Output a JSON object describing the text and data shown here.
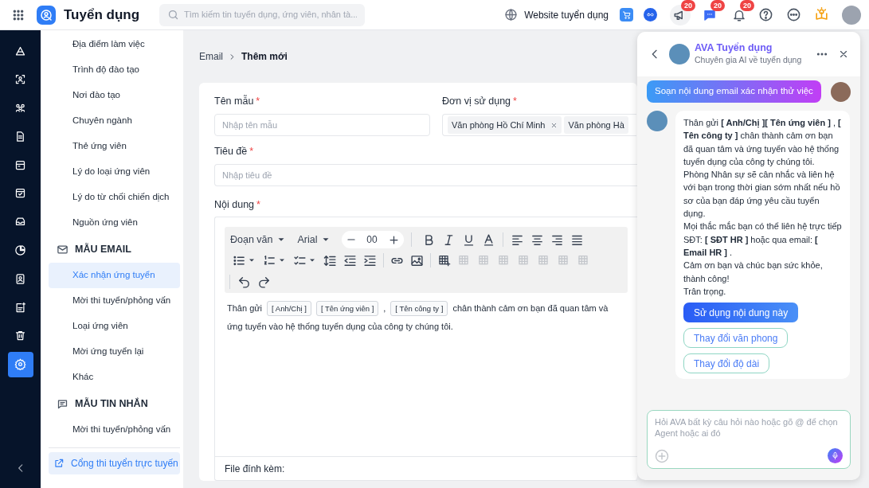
{
  "topbar": {
    "app_title": "Tuyển dụng",
    "search_placeholder": "Tìm kiếm tin tuyển dụng, ứng viên, nhân tà...",
    "website_link": "Website tuyển dụng",
    "badges": [
      "20",
      "20",
      "20"
    ]
  },
  "rail": [
    {
      "selected": false
    },
    {
      "selected": false
    },
    {
      "selected": false
    },
    {
      "selected": false
    },
    {
      "selected": false
    },
    {
      "selected": false
    },
    {
      "selected": false
    },
    {
      "selected": false
    },
    {
      "selected": false
    },
    {
      "selected": false
    },
    {
      "selected": false
    },
    {
      "selected": true
    }
  ],
  "sidebar": {
    "items": [
      {
        "label": "Địa điểm làm việc",
        "selected": false
      },
      {
        "label": "Trình độ đào tạo",
        "selected": false
      },
      {
        "label": "Nơi đào tạo",
        "selected": false
      },
      {
        "label": "Chuyên ngành",
        "selected": false
      },
      {
        "label": "Thẻ ứng viên",
        "selected": false
      },
      {
        "label": "Lý do loại ứng viên",
        "selected": false
      },
      {
        "label": "Lý do từ chối chiến dịch",
        "selected": false
      },
      {
        "label": "Nguồn ứng viên",
        "selected": false
      }
    ],
    "sections": [
      {
        "title": "MẪU EMAIL",
        "items": [
          {
            "label": "Xác nhận ứng tuyển",
            "selected": true
          },
          {
            "label": "Mời thi tuyển/phỏng vấn",
            "selected": false
          },
          {
            "label": "Loại ứng viên",
            "selected": false
          },
          {
            "label": "Mời ứng tuyển lại",
            "selected": false
          },
          {
            "label": "Khác",
            "selected": false
          }
        ]
      },
      {
        "title": "MẪU TIN NHẮN",
        "items": [
          {
            "label": "Mời thi tuyển/phỏng vấn",
            "selected": false
          }
        ]
      }
    ],
    "footer_link": "Cổng thi tuyển trực tuyến"
  },
  "breadcrumb": [
    "Email",
    "Thêm mới"
  ],
  "form": {
    "template_name": {
      "label": "Tên mẫu",
      "required_mark": "*",
      "placeholder": "Nhập tên mẫu"
    },
    "unit": {
      "label": "Đơn vị sử dụng",
      "required_mark": "*",
      "tags": [
        "Văn phòng Hồ Chí Minh",
        "Văn phòng Hà"
      ]
    },
    "subject": {
      "label": "Tiêu đề",
      "required_mark": "*",
      "placeholder": "Nhập tiêu đề"
    },
    "content": {
      "label": "Nội dung",
      "required_mark": "*"
    },
    "editor": {
      "block_format": "Đoạn văn",
      "font": "Arial",
      "font_size": "00",
      "table_tools": [
        {
          "disabled": false
        },
        {
          "disabled": true
        },
        {
          "disabled": true
        },
        {
          "disabled": true
        },
        {
          "disabled": true
        },
        {
          "disabled": true
        },
        {
          "disabled": true
        },
        {
          "disabled": true
        }
      ],
      "body": [
        {
          "kind": "text",
          "text": "Thân gửi"
        },
        {
          "kind": "chip",
          "text": "[ Anh/Chị ]"
        },
        {
          "kind": "chip",
          "text": "[ Tên ứng viên ]"
        },
        {
          "kind": "text",
          "text": ","
        },
        {
          "kind": "chip",
          "text": "[ Tên công ty ]"
        },
        {
          "kind": "text",
          "text": "chân thành cảm ơn bạn đã quan tâm và"
        },
        {
          "kind": "text",
          "text": "ứng tuyển vào hệ thống tuyển dụng của công ty chúng tôi."
        }
      ]
    },
    "attachments_label": "File đính kèm:"
  },
  "chat": {
    "title": "AVA Tuyển dụng",
    "subtitle": "Chuyên gia AI về tuyển dụng",
    "user_message": "Soạn nội dung email xác nhận thử việc",
    "bot_paragraphs": [
      "Thân gửi **[ Anh/Chị ][ Tên ứng viên ]** , **[ Tên công ty ]** chân thành cảm ơn bạn đã quan tâm và ứng tuyển vào hệ thống tuyển dụng của công ty chúng tôi.",
      "Phòng Nhân sự sẽ cân nhắc và liên hệ với bạn trong thời gian sớm nhất nếu hồ sơ của bạn đáp ứng yêu cầu tuyển dụng.",
      "Mọi thắc mắc bạn có thể liên hệ trực tiếp SĐT: **[ SĐT HR ]** hoặc qua email: **[ Email HR ]** .",
      "Cảm ơn bạn và chúc bạn sức khỏe, thành công!",
      "Trân trọng."
    ],
    "actions": [
      {
        "kind": "primary",
        "label": "Sử dụng nội dung này"
      },
      {
        "kind": "outline",
        "label": "Thay đổi văn phong"
      },
      {
        "kind": "outline",
        "label": "Thay đổi độ dài"
      }
    ],
    "input_placeholder": "Hỏi AVA bất kỳ câu hỏi nào hoặc gõ @ để chọn Agent hoặc ai đó"
  }
}
